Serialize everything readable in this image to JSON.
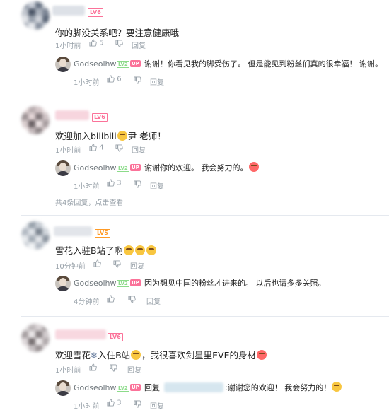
{
  "comments": [
    {
      "level": "LV6",
      "level_color": "#fb7299",
      "text": "你的脚没关系吧？要注意健康哦",
      "time": "1小时前",
      "likes": "5",
      "reply_label": "回复",
      "replies": [
        {
          "user": "Godseolhwa",
          "lv": "LV2",
          "up": "UP",
          "text": "谢谢！你看见我的脚受伤了。 但是能见到粉丝们真的很幸福！ 谢谢。",
          "time": "1小时前",
          "likes": "6",
          "reply_label": "回复"
        }
      ]
    },
    {
      "level": "LV6",
      "level_color": "#fb7299",
      "text_before": "欢迎加入bilibili",
      "text_after": "尹 老师！",
      "time": "1小时前",
      "likes": "4",
      "reply_label": "回复",
      "replies": [
        {
          "user": "Godseolhwa",
          "lv": "LV2",
          "up": "UP",
          "text": "谢谢你的欢迎。 我会努力的。",
          "time": "1小时前",
          "likes": "3",
          "reply_label": "回复"
        }
      ],
      "more": "共4条回复，点击查看"
    },
    {
      "level": "LV5",
      "level_color": "#ff9b26",
      "text": "雪花入驻B站了啊",
      "time": "10分钟前",
      "likes": "",
      "reply_label": "回复",
      "replies": [
        {
          "user": "Godseolhwa",
          "lv": "LV2",
          "up": "UP",
          "text": "因为想见中国的粉丝才进来的。 以后也请多多关照。",
          "time": "4分钟前",
          "likes": "",
          "reply_label": "回复"
        }
      ]
    },
    {
      "level": "LV6",
      "level_color": "#fb7299",
      "text_before": "欢迎雪花",
      "text_mid": "入住B站",
      "text_after": "，我很喜欢剑星里EVE的身材",
      "time": "1小时前",
      "likes": "",
      "reply_label": "回复",
      "replies": [
        {
          "user": "Godseolhwa",
          "lv": "LV2",
          "up": "UP",
          "reply_prefix": "回复",
          "text": ":谢谢您的欢迎！ 我会努力的！",
          "time": "1小时前",
          "likes": "3",
          "reply_label": "回复"
        }
      ]
    }
  ]
}
